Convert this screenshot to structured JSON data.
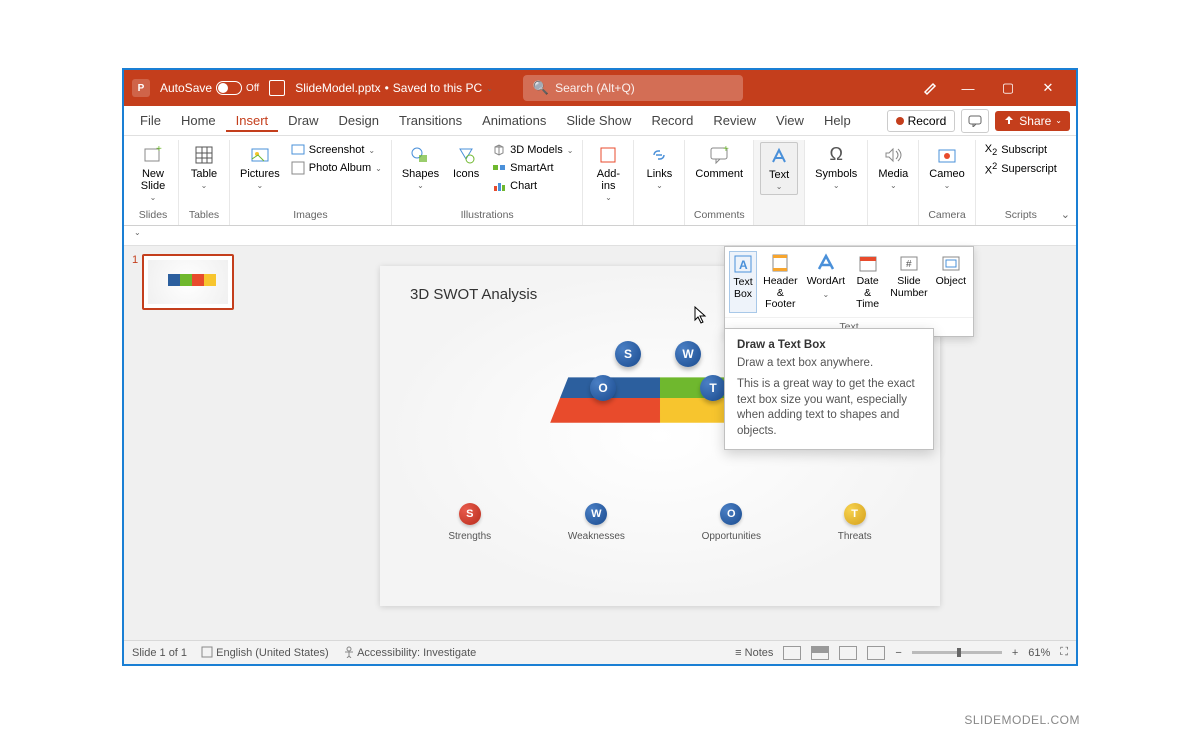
{
  "titlebar": {
    "autosave_label": "AutoSave",
    "autosave_state": "Off",
    "filename": "SlideModel.pptx",
    "save_state": "Saved to this PC",
    "search_placeholder": "Search (Alt+Q)"
  },
  "menu": {
    "tabs": [
      "File",
      "Home",
      "Insert",
      "Draw",
      "Design",
      "Transitions",
      "Animations",
      "Slide Show",
      "Record",
      "Review",
      "View",
      "Help"
    ],
    "record_btn": "Record",
    "share_btn": "Share"
  },
  "ribbon": {
    "slides": {
      "new_slide": "New\nSlide",
      "group": "Slides"
    },
    "tables": {
      "table": "Table",
      "group": "Tables"
    },
    "images": {
      "pictures": "Pictures",
      "screenshot": "Screenshot",
      "album": "Photo Album",
      "group": "Images"
    },
    "illustrations": {
      "shapes": "Shapes",
      "icons": "Icons",
      "models": "3D Models",
      "smartart": "SmartArt",
      "chart": "Chart",
      "group": "Illustrations"
    },
    "addins": {
      "label": "Add-\nins"
    },
    "links": {
      "label": "Links"
    },
    "comment": {
      "label": "Comment",
      "group": "Comments"
    },
    "text": {
      "label": "Text"
    },
    "symbols": {
      "label": "Symbols"
    },
    "media": {
      "label": "Media"
    },
    "cameo": {
      "label": "Cameo",
      "group": "Camera"
    },
    "scripts": {
      "sub": "Subscript",
      "sup": "Superscript",
      "group": "Scripts"
    }
  },
  "text_dropdown": {
    "items": [
      {
        "label": "Text\nBox"
      },
      {
        "label": "Header\n& Footer"
      },
      {
        "label": "WordArt"
      },
      {
        "label": "Date &\nTime"
      },
      {
        "label": "Slide\nNumber"
      },
      {
        "label": "Object"
      }
    ],
    "group": "Text"
  },
  "tooltip": {
    "title": "Draw a Text Box",
    "sub": "Draw a text box anywhere.",
    "body": "This is a great way to get the exact text box size you want, especially when adding text to shapes and objects."
  },
  "thumb": {
    "number": "1"
  },
  "slide": {
    "title": "3D SWOT Analysis",
    "letters": {
      "s": "S",
      "w": "W",
      "o": "O",
      "t": "T"
    },
    "legend": [
      {
        "letter": "S",
        "label": "Strengths",
        "color": "red"
      },
      {
        "letter": "W",
        "label": "Weaknesses",
        "color": "blue"
      },
      {
        "letter": "O",
        "label": "Opportunities",
        "color": "blue"
      },
      {
        "letter": "T",
        "label": "Threats",
        "color": "yellow"
      }
    ]
  },
  "status": {
    "slide_info": "Slide 1 of 1",
    "language": "English (United States)",
    "accessibility": "Accessibility: Investigate",
    "notes": "Notes",
    "zoom": "61%"
  },
  "watermark": "SLIDEMODEL.COM"
}
